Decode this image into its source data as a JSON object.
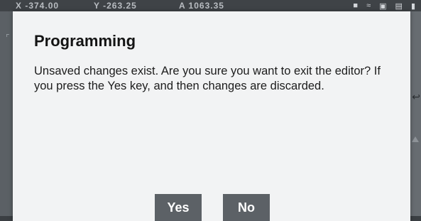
{
  "background": {
    "coords": [
      "X -374.00",
      "Y -263.25",
      "A 1063.35"
    ],
    "status_icons": [
      "lock-icon",
      "wifi-icon",
      "screen-icon",
      "document-icon",
      "battery-icon"
    ]
  },
  "dialog": {
    "title": "Programming",
    "message": "Unsaved changes exist. Are you sure you want to exit the editor? If you press the Yes key, and then changes are discarded.",
    "buttons": {
      "yes": "Yes",
      "no": "No"
    }
  },
  "colors": {
    "dialog_bg": "#f2f3f4",
    "button_bg": "#5c6166",
    "button_text": "#ffffff",
    "overlay_bg": "#4a4e53"
  }
}
